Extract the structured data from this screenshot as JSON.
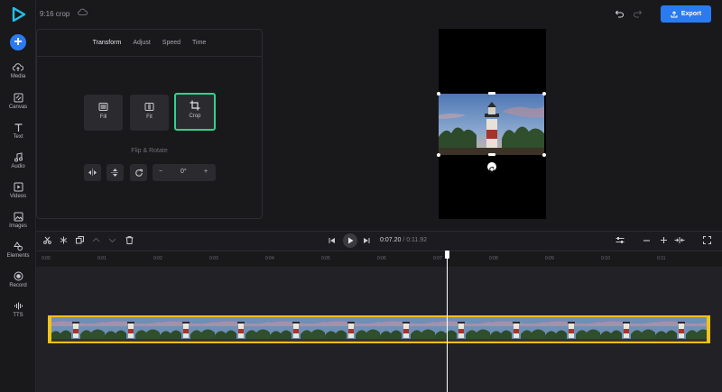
{
  "header": {
    "project_name": "9:16 crop",
    "export_label": "Export",
    "icons": [
      "logo-icon",
      "cloud-icon",
      "undo-icon",
      "redo-icon",
      "upload-icon"
    ]
  },
  "sidebar": {
    "add_label": "+",
    "items": [
      {
        "label": "Media",
        "icon": "cloud-upload-icon"
      },
      {
        "label": "Canvas",
        "icon": "canvas-icon"
      },
      {
        "label": "Text",
        "icon": "text-icon"
      },
      {
        "label": "Audio",
        "icon": "music-note-icon"
      },
      {
        "label": "Videos",
        "icon": "play-square-icon"
      },
      {
        "label": "Images",
        "icon": "image-icon"
      },
      {
        "label": "Elements",
        "icon": "shapes-icon"
      },
      {
        "label": "Record",
        "icon": "record-icon"
      },
      {
        "label": "TTS",
        "icon": "waveform-icon"
      }
    ]
  },
  "panel": {
    "tabs": [
      {
        "label": "Transform",
        "active": true
      },
      {
        "label": "Adjust",
        "active": false
      },
      {
        "label": "Speed",
        "active": false
      },
      {
        "label": "Time",
        "active": false
      }
    ],
    "options": [
      {
        "label": "Fill",
        "selected": false
      },
      {
        "label": "Fit",
        "selected": false
      },
      {
        "label": "Crop",
        "selected": true
      }
    ],
    "flip_rotate_title": "Flip & Rotate",
    "rotation": {
      "minus": "−",
      "value": "0°",
      "plus": "+"
    }
  },
  "timeline": {
    "current_time": "0:07.20",
    "separator": "/",
    "total_time": "0:11.92",
    "ruler_ticks": [
      "0:00",
      "0:01",
      "0:02",
      "0:03",
      "0:04",
      "0:05",
      "0:06",
      "0:07",
      "0:08",
      "0:09",
      "0:10",
      "0:11"
    ],
    "playhead_progress": 0.604
  },
  "colors": {
    "accent": "#2b7bf0",
    "selected_border": "#2fd38c",
    "track_border": "#f3c318",
    "background": "#19191c"
  }
}
